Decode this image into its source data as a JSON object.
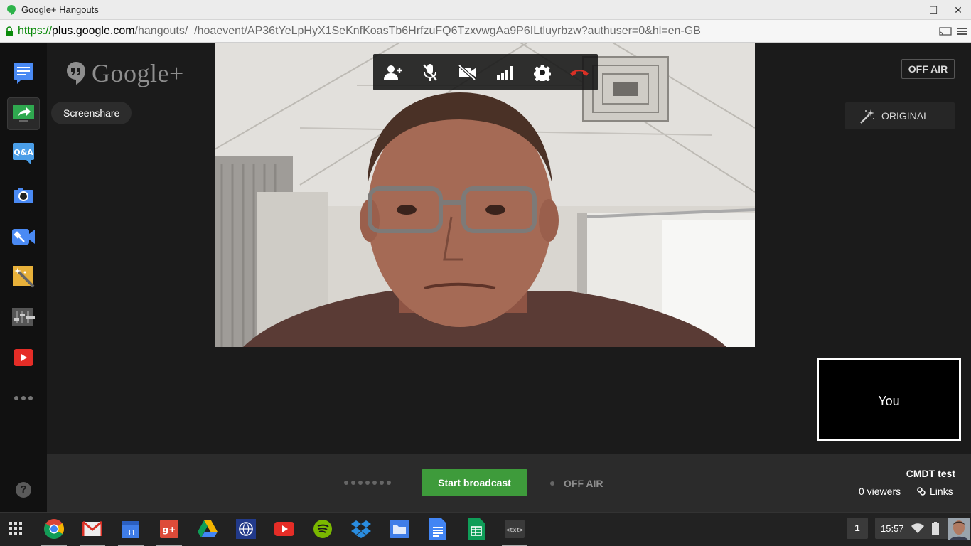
{
  "window": {
    "title": "Google+ Hangouts",
    "minimize_label": "–",
    "maximize_label": "☐",
    "close_label": "✕"
  },
  "address": {
    "scheme": "https://",
    "host": "plus.google.com",
    "path": "/hangouts/_/hoaevent/AP36tYeLpHyX1SeKnfKoasTb6HrfzuFQ6TzxvwgAa9P6ILtluyrbzw?authuser=0&hl=en-GB"
  },
  "rail": {
    "items": [
      {
        "name": "chat-icon"
      },
      {
        "name": "screenshare-icon"
      },
      {
        "name": "qa-icon",
        "label": "Q&A"
      },
      {
        "name": "camera-icon"
      },
      {
        "name": "control-room-icon"
      },
      {
        "name": "effects-icon"
      },
      {
        "name": "cameraman-icon"
      },
      {
        "name": "youtube-icon"
      },
      {
        "name": "more-icon"
      }
    ]
  },
  "logo": {
    "text": "Google+"
  },
  "tooltip": {
    "text": "Screenshare"
  },
  "toolbar": {
    "buttons": [
      "invite-icon",
      "mute-mic-icon",
      "camera-off-icon",
      "bandwidth-icon",
      "settings-icon",
      "hangup-icon"
    ]
  },
  "broadcast": {
    "status_top": "OFF AIR",
    "original_label": "ORIGINAL",
    "start_label": "Start broadcast",
    "status_bottom": "OFF AIR",
    "event_name": "CMDT test",
    "viewers": "0 viewers",
    "links_label": "Links"
  },
  "self_view": {
    "label": "You"
  },
  "help": {
    "label": "?"
  },
  "shelf": {
    "apps": [
      "chrome",
      "gmail",
      "calendar",
      "google-plus",
      "drive",
      "app-unknown",
      "youtube",
      "spotify",
      "dropbox",
      "files",
      "docs",
      "sheets",
      "text"
    ],
    "calendar_day": "31",
    "gplus_label": "g+",
    "text_label": "<txt>",
    "notification_count": "1",
    "clock": "15:57"
  },
  "colors": {
    "accent_green": "#3e9b3b",
    "hangup_red": "#d93025",
    "stage_bg": "#1b1b1b"
  }
}
